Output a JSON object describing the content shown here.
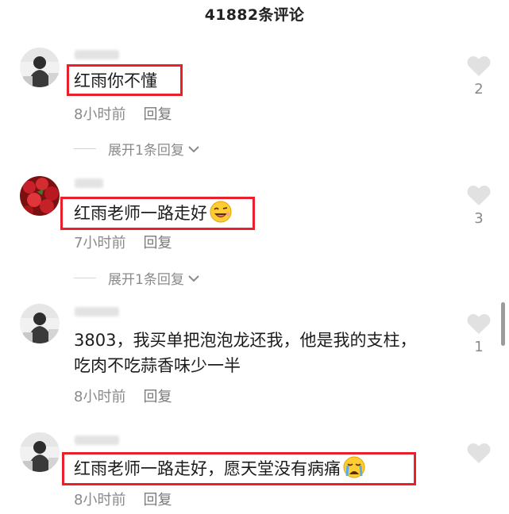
{
  "header": {
    "title": "41882条评论"
  },
  "comments": [
    {
      "text": "红雨你不懂",
      "time": "8小时前",
      "reply_label": "回复",
      "likes": "2",
      "expand_label": "展开1条回复",
      "avatar_icon": "user-photo-avatar"
    },
    {
      "text": "红雨老师一路走好",
      "emoji": "grinning-wink-emoji",
      "time": "7小时前",
      "reply_label": "回复",
      "likes": "3",
      "expand_label": "展开1条回复",
      "avatar_icon": "red-berries-avatar"
    },
    {
      "text": "3803，我买单把泡泡龙还我，他是我的支柱，吃肉不吃蒜香味少一半",
      "time": "8小时前",
      "reply_label": "回复",
      "likes": "1",
      "avatar_icon": "user-photo-avatar"
    },
    {
      "text": "红雨老师一路走好，愿天堂没有病痛",
      "emoji": "crying-face-emoji",
      "time": "8小时前",
      "reply_label": "回复",
      "likes": "",
      "avatar_icon": "user-photo-avatar"
    }
  ],
  "colors": {
    "highlight_box": "#e8202a",
    "meta_text": "#8a8a8a",
    "like_icon": "#e1e1e1"
  }
}
